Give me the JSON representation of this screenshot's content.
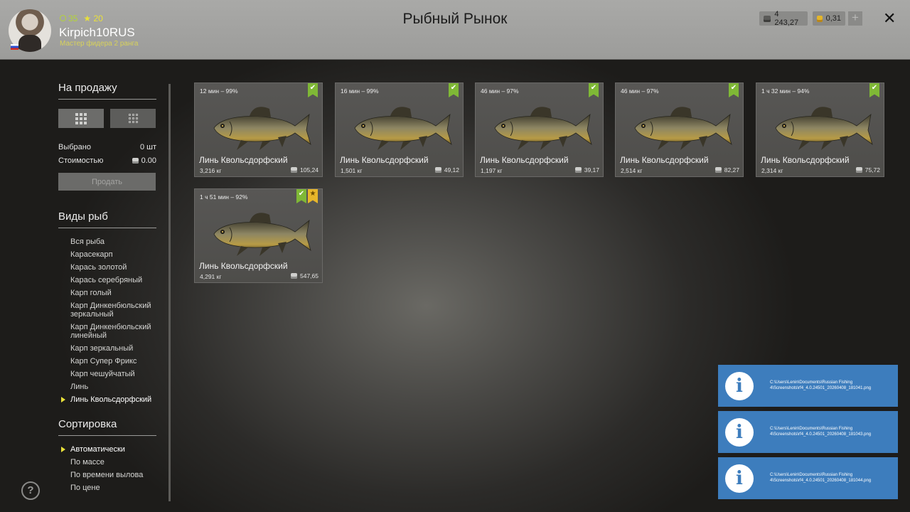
{
  "header": {
    "title": "Рыбный Рынок",
    "player": {
      "level": "35",
      "stars": "20",
      "username": "Kirpich10RUS",
      "rank": "Мастер фидера 2 ранга"
    },
    "silver": "4 243,27",
    "gold": "0,31",
    "plus": "+",
    "close": "✕"
  },
  "sidebar": {
    "for_sale_title": "На продажу",
    "selected_label": "Выбрано",
    "selected_value": "0 шт",
    "cost_label": "Стоимостью",
    "cost_value": "0.00",
    "sell_label": "Продать",
    "species_title": "Виды рыб",
    "species": [
      "Вся рыба",
      "Карасекарп",
      "Карась золотой",
      "Карась серебряный",
      "Карп голый",
      "Карп Динкенбюльский зеркальный",
      "Карп Динкенбюльский линейный",
      "Карп зеркальный",
      "Карп Супер Фрикс",
      "Карп чешуйчатый",
      "Линь",
      "Линь Квольсдорфский"
    ],
    "sort_title": "Сортировка",
    "sort_options": [
      "Автоматически",
      "По массе",
      "По времени вылова",
      "По цене"
    ],
    "help": "?"
  },
  "cards": [
    {
      "time": "12 мин – 99%",
      "name": "Линь Квольсдорфский",
      "weight": "3,216 кг",
      "price": "105,24"
    },
    {
      "time": "16 мин – 99%",
      "name": "Линь Квольсдорфский",
      "weight": "1,501 кг",
      "price": "49,12"
    },
    {
      "time": "46 мин – 97%",
      "name": "Линь Квольсдорфский",
      "weight": "1,197 кг",
      "price": "39,17"
    },
    {
      "time": "46 мин – 97%",
      "name": "Линь Квольсдорфский",
      "weight": "2,514 кг",
      "price": "82,27"
    },
    {
      "time": "1 ч 32 мин – 94%",
      "name": "Линь Квольсдорфский",
      "weight": "2,314 кг",
      "price": "75,72"
    },
    {
      "time": "1 ч 51 мин – 92%",
      "name": "Линь Квольсдорфский",
      "weight": "4,291 кг",
      "price": "547,65"
    }
  ],
  "notifications": [
    "C:\\Users\\Lenin\\Documents\\Russian Fishing 4\\Screenshots\\rf4_4.0.24501_20260408_181041.png",
    "C:\\Users\\Lenin\\Documents\\Russian Fishing 4\\Screenshots\\rf4_4.0.24501_20260408_181043.png",
    "C:\\Users\\Lenin\\Documents\\Russian Fishing 4\\Screenshots\\rf4_4.0.24501_20260408_181044.png"
  ],
  "colors": {
    "accent_yellow": "#e8e03a",
    "badge_green": "#7fb836",
    "badge_gold": "#e7b62a",
    "notification_blue": "#3d7dbd"
  }
}
